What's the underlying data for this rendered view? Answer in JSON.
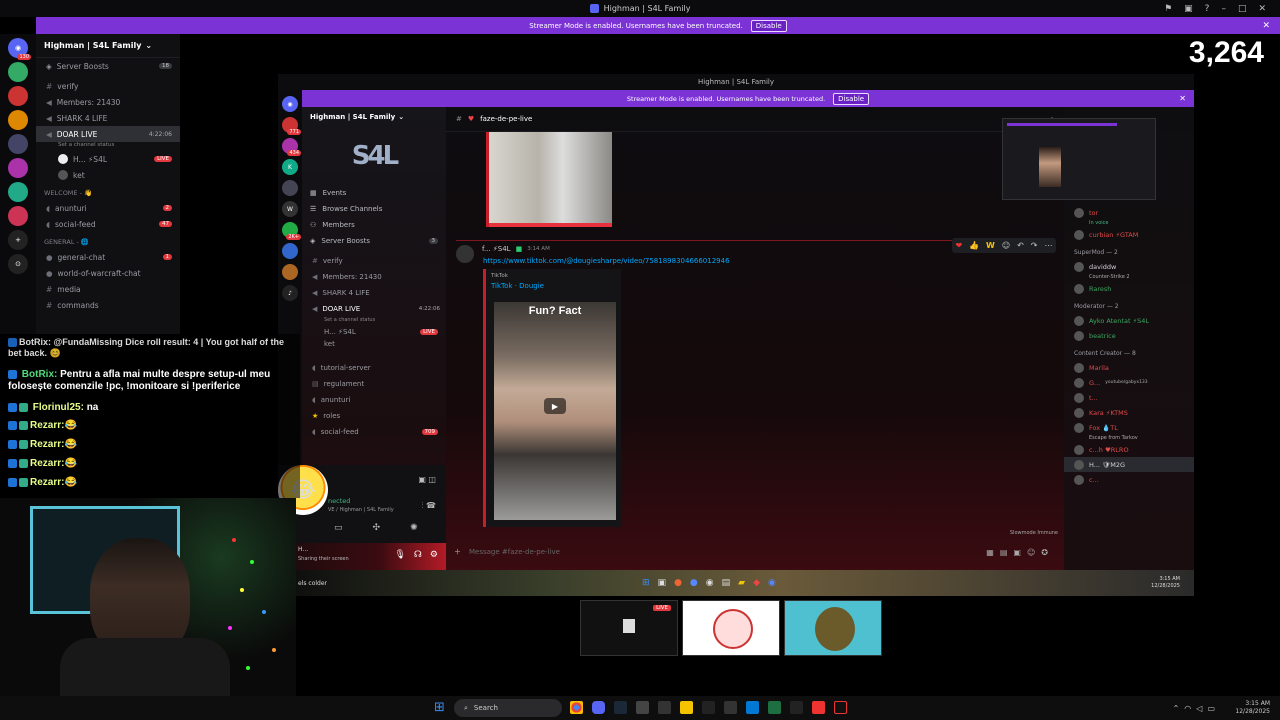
{
  "outer": {
    "title": "Highman | S4L Family",
    "banner_text": "Streamer Mode is enabled. Usernames have been truncated.",
    "disable_label": "Disable",
    "server_name": "Highman | S4L Family",
    "server_boosts": "Server Boosts",
    "server_boosts_count": "18",
    "guild_badges": [
      "130",
      "",
      "",
      "",
      "",
      "",
      "",
      "",
      "",
      ""
    ],
    "channels": [
      {
        "name": "verify",
        "badge": ""
      },
      {
        "name": "Members: 21430",
        "badge": ""
      },
      {
        "name": "SHARK 4 LIFE",
        "badge": ""
      }
    ],
    "voice_channel": "DOAR LIVE",
    "voice_time": "4:22:06",
    "voice_status": "Set a channel status",
    "voice_user1": "H... ⚡S4L",
    "voice_user2": "ket",
    "live_label": "LIVE",
    "cat_welcome": "WELCOME - 👋",
    "welcome_channels": [
      {
        "name": "anunturi",
        "badge": "2"
      },
      {
        "name": "social-feed",
        "badge": "47"
      }
    ],
    "cat_general": "GENERAL - 🌐",
    "general_channels": [
      {
        "name": "general-chat",
        "badge": "1"
      },
      {
        "name": "world-of-warcraft-chat",
        "badge": ""
      },
      {
        "name": "media",
        "badge": ""
      },
      {
        "name": "commands",
        "badge": ""
      }
    ]
  },
  "viewer_count": "3,264",
  "inner": {
    "title": "Highman | S4L Family",
    "banner_text": "Streamer Mode is enabled. Usernames have been truncated.",
    "disable_label": "Disable",
    "server_name": "Highman | S4L Family",
    "nav": [
      {
        "label": "Events",
        "icon": "calendar-icon"
      },
      {
        "label": "Browse Channels",
        "icon": "browse-icon"
      },
      {
        "label": "Members",
        "icon": "members-icon"
      },
      {
        "label": "Server Boosts",
        "icon": "boost-icon"
      }
    ],
    "boost_count": "3",
    "channels": [
      "verify",
      "Members: 21430",
      "SHARK 4 LIFE"
    ],
    "voice_channel": "DOAR LIVE",
    "voice_time": "4:22:06",
    "voice_status": "Set a channel status",
    "voice_user1": "H... ⚡S4L",
    "voice_user2": "ket",
    "live_label": "LIVE",
    "more_channels": [
      {
        "name": "tutorial-server",
        "badge": ""
      },
      {
        "name": "regulament",
        "badge": ""
      },
      {
        "name": "anunturi",
        "badge": ""
      },
      {
        "name": "roles",
        "badge": ""
      },
      {
        "name": "social-feed",
        "badge": "709"
      }
    ],
    "voice_connected": "nected",
    "voice_connected_sub": "VE / Highman | S4L Family",
    "sharing": "Sharing their screen",
    "guild_badges": [
      "771",
      "434",
      "",
      "",
      "2K+",
      "",
      "",
      ""
    ],
    "chat": {
      "channel": "faze-de-pe-live",
      "author": "f... ⚡S4L",
      "time": "3:14 AM",
      "link": "https://www.tiktok.com/@dougiesharpe/video/7581898304666012946",
      "embed_provider": "TikTok",
      "embed_title": "TikTok · Dougie",
      "video_caption": "Fun? Fact",
      "reactions": [
        "❤",
        "👍",
        "W"
      ],
      "slowmode": "Slowmode Immune",
      "input_placeholder": "Message #faze-de-pe-live"
    },
    "members": {
      "top": [
        {
          "name": "tor",
          "sub": "In voice",
          "color": "red"
        },
        {
          "name": "bo⚡S4L",
          "sub": "",
          "color": "red"
        },
        {
          "name": "curbian ⚡GTAM",
          "sub": "",
          "color": "red"
        }
      ],
      "supermod_header": "SuperMod — 2",
      "supermods": [
        {
          "name": "daviddw",
          "sub": "Counter-Strike 2"
        },
        {
          "name": "Raresh",
          "sub": ""
        }
      ],
      "mod_header": "Moderator — 2",
      "mods": [
        {
          "name": "Ayko Atentat ⚡S4L",
          "sub": ""
        },
        {
          "name": "beatrice",
          "sub": ""
        }
      ],
      "cc_header": "Content Creator — 8",
      "ccs": [
        {
          "name": "Marila",
          "sub": ""
        },
        {
          "name": "G...",
          "sub": "youtube/gabyx133"
        },
        {
          "name": "t...",
          "sub": ""
        },
        {
          "name": "Kara ⚡KTMS",
          "sub": ""
        },
        {
          "name": "Fox 💧TL",
          "sub": "Escape from Tarkov"
        },
        {
          "name": "c...h ♥RLRO",
          "sub": ""
        },
        {
          "name": "H... 🛡M2G",
          "sub": ""
        },
        {
          "name": "c...",
          "sub": ""
        }
      ]
    },
    "taskbar_text": "els colder",
    "taskbar_time": "3:15 AM",
    "taskbar_date": "12/28/2025"
  },
  "overlay": {
    "line0": "BotRix: @FundaMissing Dice roll result: 4 | You got half of the bet back. 😊",
    "line1_name": "BotRix:",
    "line1_text": "Pentru a afla mai multe despre setup-ul meu folosește comenzile !pc, !monitoare si !periferice",
    "line2_name": "Florinul25:",
    "line2_text": "na",
    "rezarr_name": "Rezarr:",
    "rezarr_emote": "😂"
  },
  "obs_thumbs": {
    "live_label": "LIVE"
  },
  "taskbar": {
    "search_placeholder": "Search",
    "time": "3:15 AM",
    "date": "12/28/2025"
  }
}
